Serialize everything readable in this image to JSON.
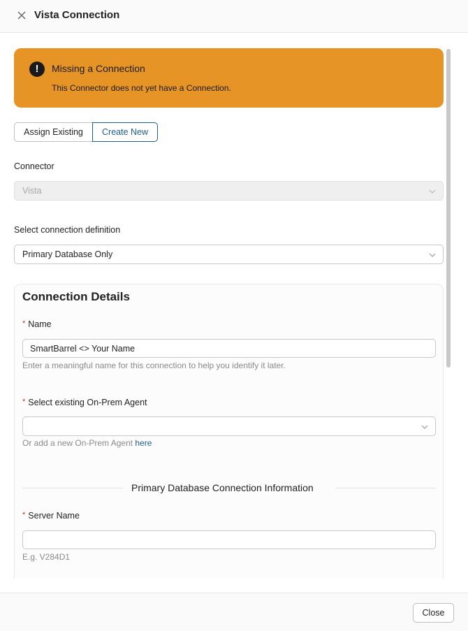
{
  "header": {
    "title": "Vista Connection"
  },
  "alert": {
    "title": "Missing a Connection",
    "message": "This Connector does not yet have a Connection.",
    "color": "#e69426"
  },
  "segmented": {
    "assign_existing": "Assign Existing",
    "create_new": "Create New",
    "selected": "Create New"
  },
  "connector": {
    "label": "Connector",
    "value": "Vista"
  },
  "definition": {
    "label": "Select connection definition",
    "value": "Primary Database Only"
  },
  "details": {
    "title": "Connection Details",
    "name_label": "Name",
    "name_value": "SmartBarrel <> Your Name",
    "name_hint": "Enter a meaningful name for this connection to help you identify it later.",
    "agent_label": "Select existing On-Prem Agent",
    "agent_value": "",
    "agent_hint_prefix": "Or add a new On-Prem Agent ",
    "agent_hint_link": "here",
    "section_title": "Primary Database Connection Information",
    "server_label": "Server Name",
    "server_value": "",
    "server_hint": "E.g. V284D1"
  },
  "footer": {
    "close_label": "Close"
  },
  "colors": {
    "accent": "#1b5e8a",
    "required": "#c0392b"
  }
}
